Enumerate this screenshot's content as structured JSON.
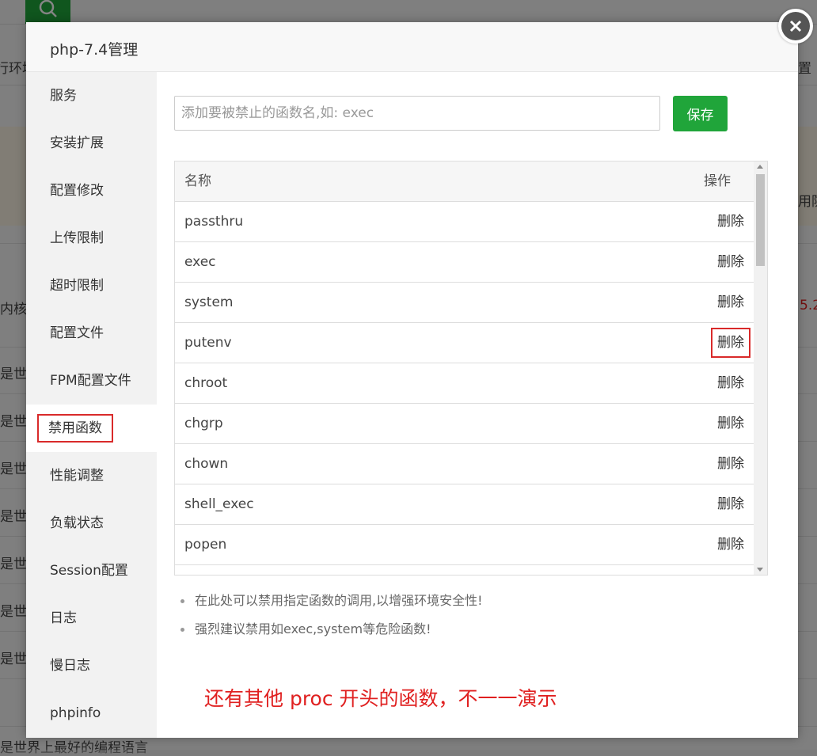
{
  "background": {
    "left_fragments": [
      "行环境",
      "内核",
      "是世",
      "是世",
      "是世",
      "是世",
      "是世",
      "是世",
      "是世",
      "是世界上最好的编程语言"
    ],
    "right_fragments": [
      "置",
      "用防",
      "5.2"
    ]
  },
  "modal": {
    "title": "php-7.4管理",
    "close_icon": "close-icon"
  },
  "sidebar": {
    "items": [
      {
        "label": "服务"
      },
      {
        "label": "安装扩展"
      },
      {
        "label": "配置修改"
      },
      {
        "label": "上传限制"
      },
      {
        "label": "超时限制"
      },
      {
        "label": "配置文件"
      },
      {
        "label": "FPM配置文件"
      },
      {
        "label": "禁用函数",
        "active": true
      },
      {
        "label": "性能调整"
      },
      {
        "label": "负载状态"
      },
      {
        "label": "Session配置"
      },
      {
        "label": "日志"
      },
      {
        "label": "慢日志"
      },
      {
        "label": "phpinfo"
      }
    ]
  },
  "form": {
    "placeholder": "添加要被禁止的函数名,如: exec",
    "save_label": "保存"
  },
  "table": {
    "headers": {
      "name": "名称",
      "action": "操作"
    },
    "rows": [
      {
        "name": "passthru",
        "action": "删除"
      },
      {
        "name": "exec",
        "action": "删除"
      },
      {
        "name": "system",
        "action": "删除"
      },
      {
        "name": "putenv",
        "action": "删除"
      },
      {
        "name": "chroot",
        "action": "删除"
      },
      {
        "name": "chgrp",
        "action": "删除"
      },
      {
        "name": "chown",
        "action": "删除"
      },
      {
        "name": "shell_exec",
        "action": "删除"
      },
      {
        "name": "popen",
        "action": "删除"
      }
    ]
  },
  "tips": [
    "在此处可以禁用指定函数的调用,以增强环境安全性!",
    "强烈建议禁用如exec,system等危险函数!"
  ],
  "annotation": "还有其他 proc 开头的函数，不一一演示",
  "colors": {
    "accent_green": "#20a53a",
    "highlight_red": "#d92a2a",
    "annotation_red": "#e02020"
  }
}
